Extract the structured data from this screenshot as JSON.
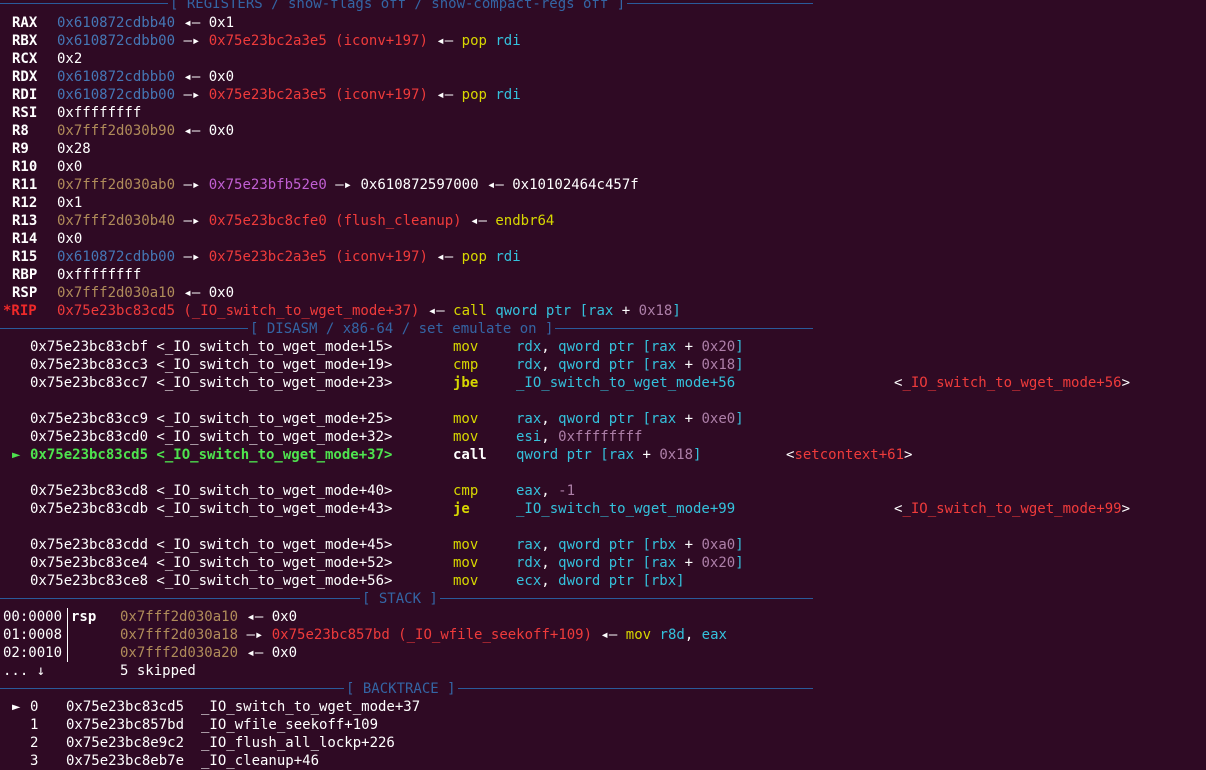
{
  "headers": {
    "registers": "[ REGISTERS / show-flags off / show-compact-regs off ]",
    "disasm": "[ DISASM / x86-64 / set emulate on ]",
    "stack": "[ STACK ]",
    "backtrace": "[ BACKTRACE ]"
  },
  "registers": {
    "rax": {
      "name": "RAX",
      "v1": "0x610872cdbb40",
      "v2": "0x1"
    },
    "rbx": {
      "name": "RBX",
      "v1": "0x610872cdbb00",
      "v2": "0x75e23bc2a3e5 (iconv+197)",
      "v3": "pop",
      "v4": "rdi"
    },
    "rcx": {
      "name": "RCX",
      "v1": "0x2"
    },
    "rdx": {
      "name": "RDX",
      "v1": "0x610872cdbbb0",
      "v2": "0x0"
    },
    "rdi": {
      "name": "RDI",
      "v1": "0x610872cdbb00",
      "v2": "0x75e23bc2a3e5 (iconv+197)",
      "v3": "pop",
      "v4": "rdi"
    },
    "rsi": {
      "name": "RSI",
      "v1": "0xffffffff"
    },
    "r8": {
      "name": "R8",
      "v1": "0x7fff2d030b90",
      "v2": "0x0"
    },
    "r9": {
      "name": "R9",
      "v1": "0x28"
    },
    "r10": {
      "name": "R10",
      "v1": "0x0"
    },
    "r11": {
      "name": "R11",
      "v1": "0x7fff2d030ab0",
      "v2": "0x75e23bfb52e0",
      "v3": "0x610872597000",
      "v4": "0x10102464c457f"
    },
    "r12": {
      "name": "R12",
      "v1": "0x1"
    },
    "r13": {
      "name": "R13",
      "v1": "0x7fff2d030b40",
      "v2": "0x75e23bc8cfe0 (flush_cleanup)",
      "v3": "endbr64"
    },
    "r14": {
      "name": "R14",
      "v1": "0x0"
    },
    "r15": {
      "name": "R15",
      "v1": "0x610872cdbb00",
      "v2": "0x75e23bc2a3e5 (iconv+197)",
      "v3": "pop",
      "v4": "rdi"
    },
    "rbp": {
      "name": "RBP",
      "v1": "0xffffffff"
    },
    "rsp": {
      "name": "RSP",
      "v1": "0x7fff2d030a10",
      "v2": "0x0"
    },
    "rip": {
      "name": "*RIP",
      "v1": "0x75e23bc83cd5 (_IO_switch_to_wget_mode+37)",
      "v2": "call",
      "v3": "qword ptr [",
      "v4": "rax",
      "v5": " + ",
      "v6": "0x18",
      "v7": "]"
    }
  },
  "disasm": [
    {
      "addr": "0x75e23bc83cbf <_IO_switch_to_wget_mode+15>",
      "mn": "mov",
      "a": "rdx",
      "b": ", ",
      "c": "qword ptr [",
      "d": "rax",
      "e": " + ",
      "f": "0x20",
      "g": "]"
    },
    {
      "addr": "0x75e23bc83cc3 <_IO_switch_to_wget_mode+19>",
      "mn": "cmp",
      "a": "rdx",
      "b": ", ",
      "c": "qword ptr [",
      "d": "rax",
      "e": " + ",
      "f": "0x18",
      "g": "]"
    },
    {
      "addr": "0x75e23bc83cc7 <_IO_switch_to_wget_mode+23>",
      "mn": "jbe",
      "op": "_IO_switch_to_wget_mode+56",
      "t1": "<",
      "t2": "_IO_switch_to_wget_mode+56",
      "t3": ">"
    },
    {
      "addr": "0x75e23bc83cc9 <_IO_switch_to_wget_mode+25>",
      "mn": "mov",
      "a": "rax",
      "b": ", ",
      "c": "qword ptr [",
      "d": "rax",
      "e": " + ",
      "f": "0xe0",
      "g": "]"
    },
    {
      "addr": "0x75e23bc83cd0 <_IO_switch_to_wget_mode+32>",
      "mn": "mov",
      "a": "esi",
      "b": ", ",
      "c": "0xffffffff"
    },
    {
      "addr": "0x75e23bc83cd5 <_IO_switch_to_wget_mode+37>",
      "mn": "call",
      "c": "qword ptr [",
      "d": "rax",
      "e": " + ",
      "f": "0x18",
      "g": "]",
      "t1": "<",
      "t2": "setcontext+61",
      "t3": ">"
    },
    {
      "addr": "0x75e23bc83cd8 <_IO_switch_to_wget_mode+40>",
      "mn": "cmp",
      "a": "eax",
      "b": ", ",
      "c": "-1"
    },
    {
      "addr": "0x75e23bc83cdb <_IO_switch_to_wget_mode+43>",
      "mn": "je",
      "op": "_IO_switch_to_wget_mode+99",
      "t1": "<",
      "t2": "_IO_switch_to_wget_mode+99",
      "t3": ">"
    },
    {
      "addr": "0x75e23bc83cdd <_IO_switch_to_wget_mode+45>",
      "mn": "mov",
      "a": "rax",
      "b": ", ",
      "c": "qword ptr [",
      "d": "rbx",
      "e": " + ",
      "f": "0xa0",
      "g": "]"
    },
    {
      "addr": "0x75e23bc83ce4 <_IO_switch_to_wget_mode+52>",
      "mn": "mov",
      "a": "rdx",
      "b": ", ",
      "c": "qword ptr [",
      "d": "rax",
      "e": " + ",
      "f": "0x20",
      "g": "]"
    },
    {
      "addr": "0x75e23bc83ce8 <_IO_switch_to_wget_mode+56>",
      "mn": "mov",
      "a": "ecx",
      "b": ", ",
      "c": "dword ptr [",
      "d": "rbx",
      "g": "]"
    }
  ],
  "current_marker": "►",
  "stack": [
    {
      "off": "00:0000",
      "reg": "rsp",
      "addr": "0x7fff2d030a10",
      "v": "0x0"
    },
    {
      "off": "01:0008",
      "addr": "0x7fff2d030a18",
      "v": "0x75e23bc857bd (_IO_wfile_seekoff+109)",
      "ins": "mov",
      "o1": "r8d",
      "o2": ", ",
      "o3": "eax"
    },
    {
      "off": "02:0010",
      "addr": "0x7fff2d030a20",
      "v": "0x0"
    },
    {
      "off": "... ↓",
      "skip": "5 skipped"
    }
  ],
  "backtrace": [
    {
      "marker": "►",
      "idx": "0",
      "addr": "0x75e23bc83cd5",
      "sym": "_IO_switch_to_wget_mode+37"
    },
    {
      "idx": "1",
      "addr": "0x75e23bc857bd",
      "sym": "_IO_wfile_seekoff+109"
    },
    {
      "idx": "2",
      "addr": "0x75e23bc8e9c2",
      "sym": "_IO_flush_all_lockp+226"
    },
    {
      "idx": "3",
      "addr": "0x75e23bc8eb7e",
      "sym": "_IO_cleanup+46"
    }
  ],
  "symbols": {
    "arrow_right": "—▸",
    "arrow_left": "◂—"
  }
}
